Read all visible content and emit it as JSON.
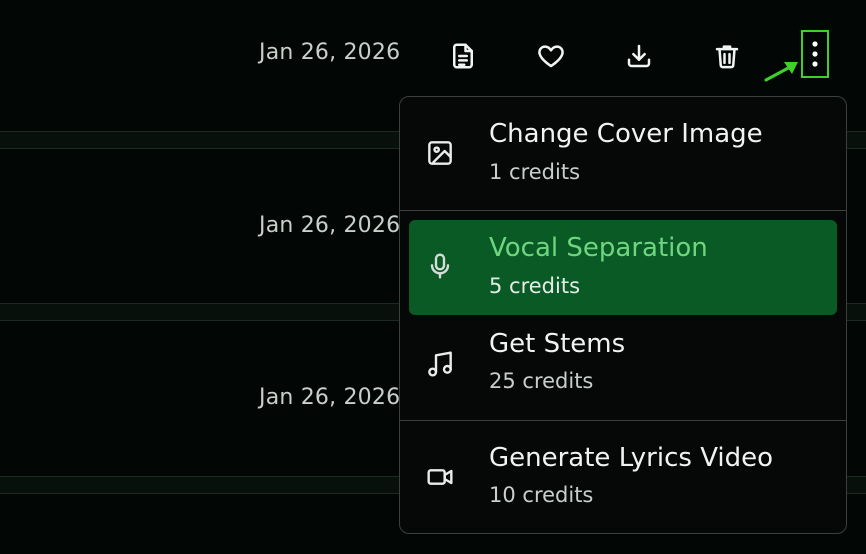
{
  "rows": [
    {
      "date": "Jan 26, 2026"
    },
    {
      "date": "Jan 26, 2026"
    },
    {
      "date": "Jan 26, 2026"
    }
  ],
  "actions": {
    "icons": [
      "document-icon",
      "heart-icon",
      "download-icon",
      "trash-icon",
      "more-vertical-icon"
    ]
  },
  "menu": {
    "items": [
      {
        "title": "Change Cover Image",
        "credits": "1 credits",
        "icon": "image-icon"
      },
      {
        "title": "Vocal Separation",
        "credits": "5 credits",
        "icon": "microphone-icon",
        "active": true
      },
      {
        "title": "Get Stems",
        "credits": "25 credits",
        "icon": "music-note-icon"
      },
      {
        "title": "Generate Lyrics Video",
        "credits": "10 credits",
        "icon": "video-camera-icon"
      }
    ]
  },
  "colors": {
    "background": "#020604",
    "highlight": "#0a5a26",
    "highlight_text": "#6fd67f",
    "annotation": "#3fd12a"
  }
}
